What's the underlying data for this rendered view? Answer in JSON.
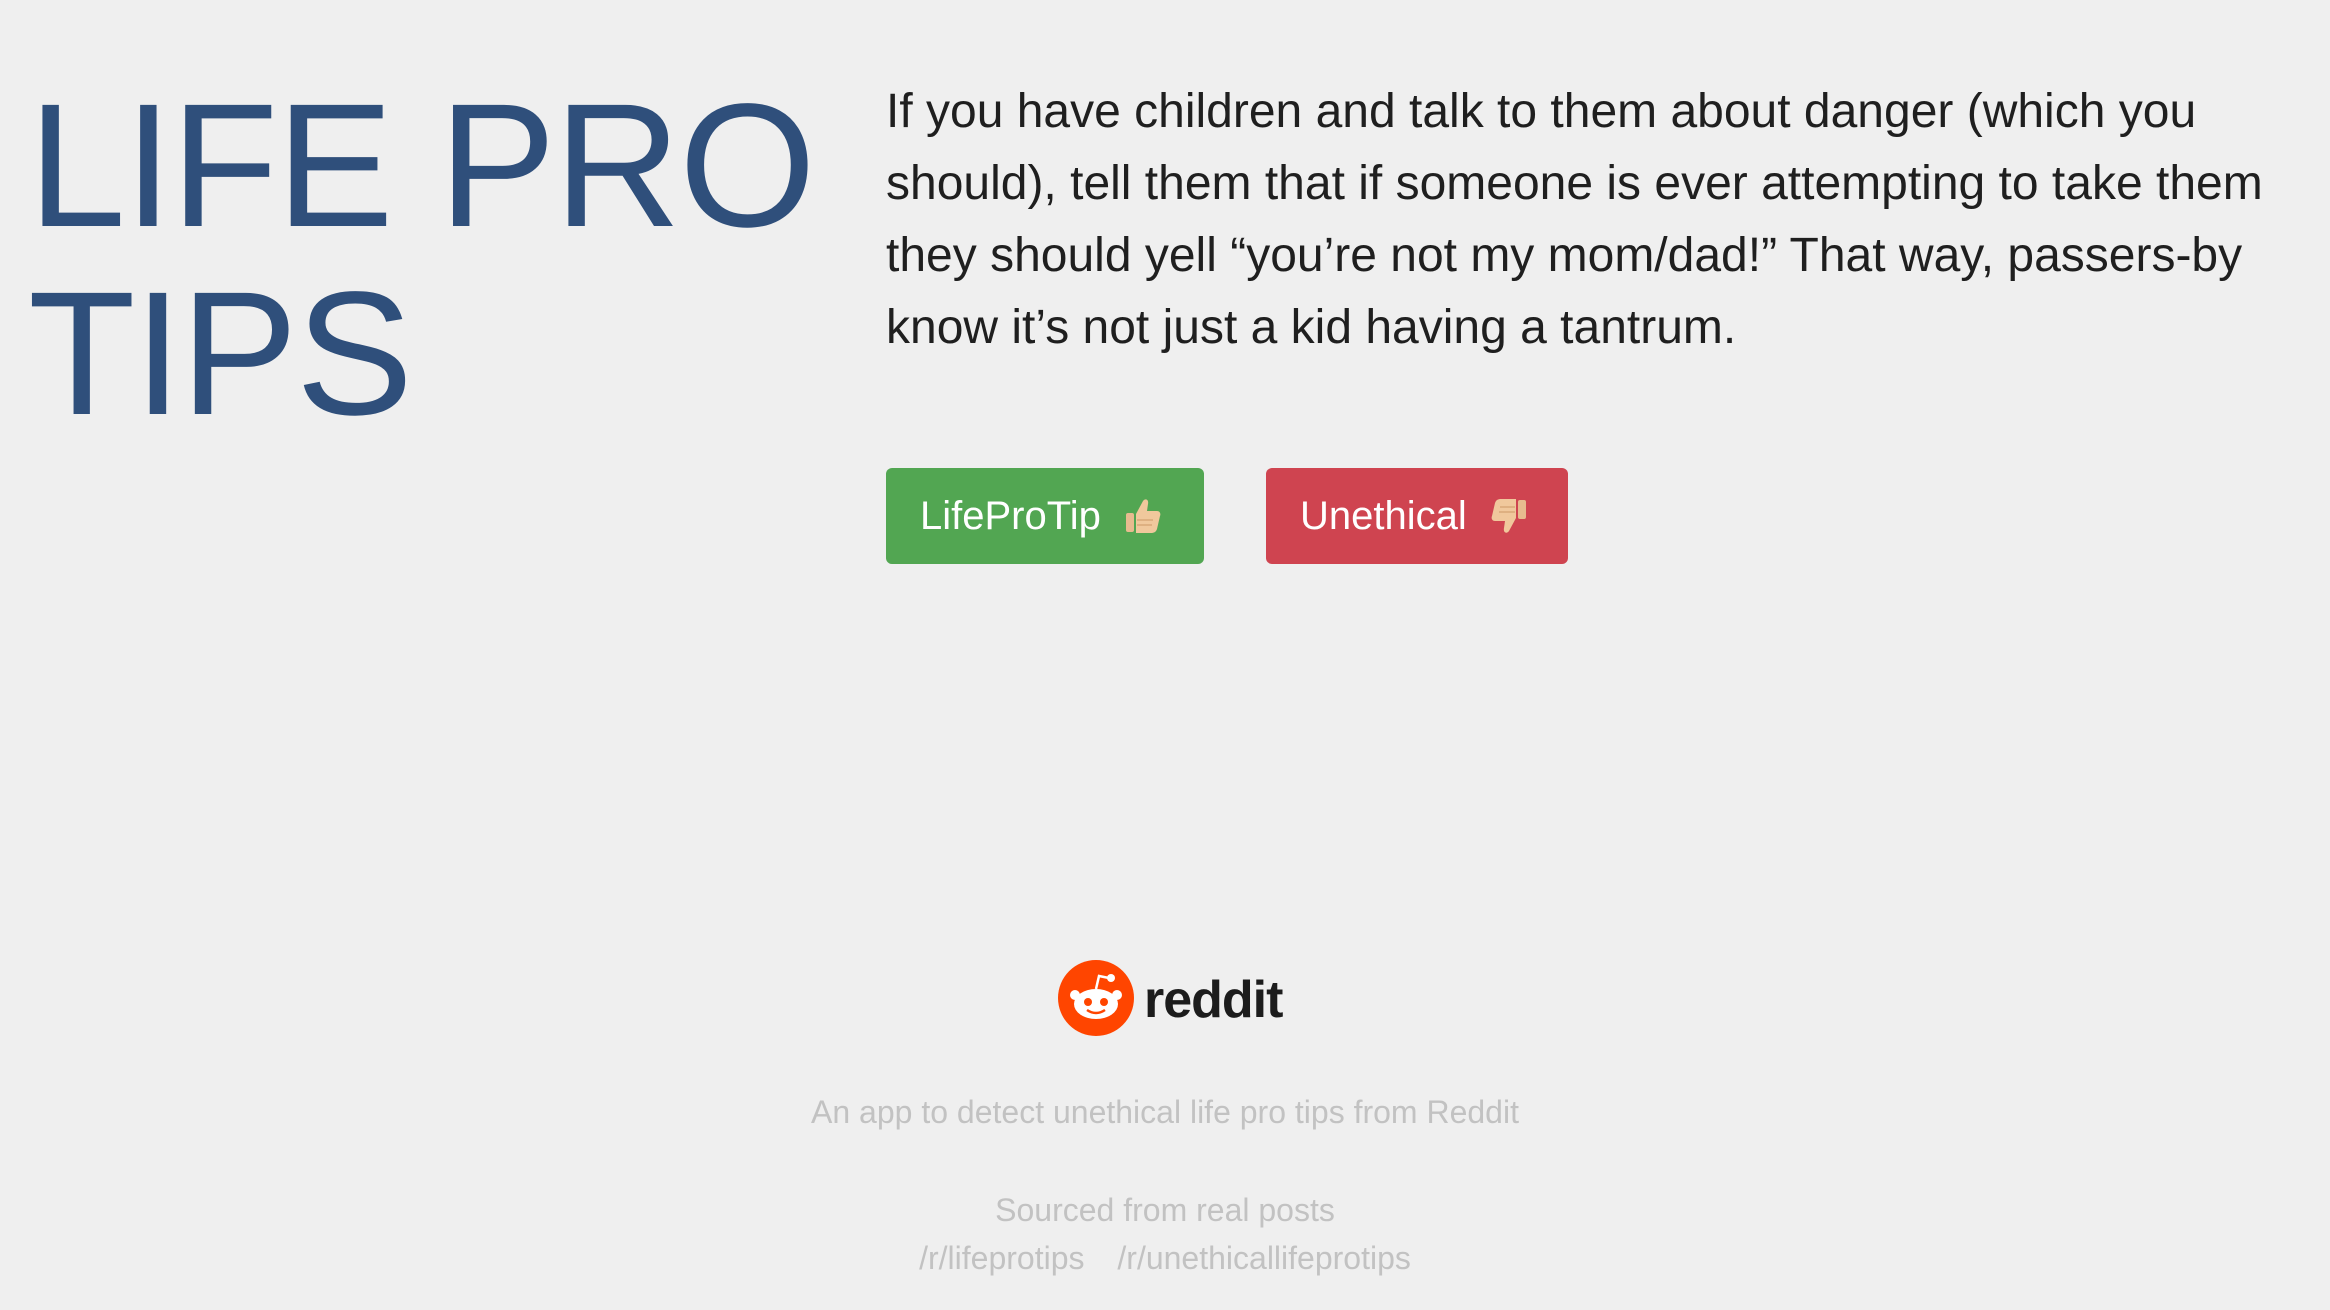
{
  "header": {
    "title_line1": "LIFE PRO",
    "title_line2": "TIPS"
  },
  "tip": {
    "text": "If you have children and talk to them about danger (which you should), tell them that if someone is ever attempting to take them they should yell “you’re not my mom/dad!” That way, passers-by know it’s not just a kid having a tantrum."
  },
  "buttons": {
    "lifeprotip": {
      "label": "LifeProTip",
      "icon": "thumbs-up-icon",
      "color": "#52a652"
    },
    "unethical": {
      "label": "Unethical",
      "icon": "thumbs-down-icon",
      "color": "#cf4450"
    }
  },
  "footer": {
    "logo_text": "reddit",
    "logo_color": "#ff4500",
    "tagline": "An app to detect unethical life pro tips from Reddit",
    "sourced": "Sourced from real posts",
    "links": [
      "/r/lifeprotips",
      "/r/unethicallifeprotips"
    ]
  },
  "colors": {
    "background": "#efefef",
    "title": "#2f4f7b",
    "text": "#1f1f1f",
    "muted": "#c2c2c2"
  }
}
